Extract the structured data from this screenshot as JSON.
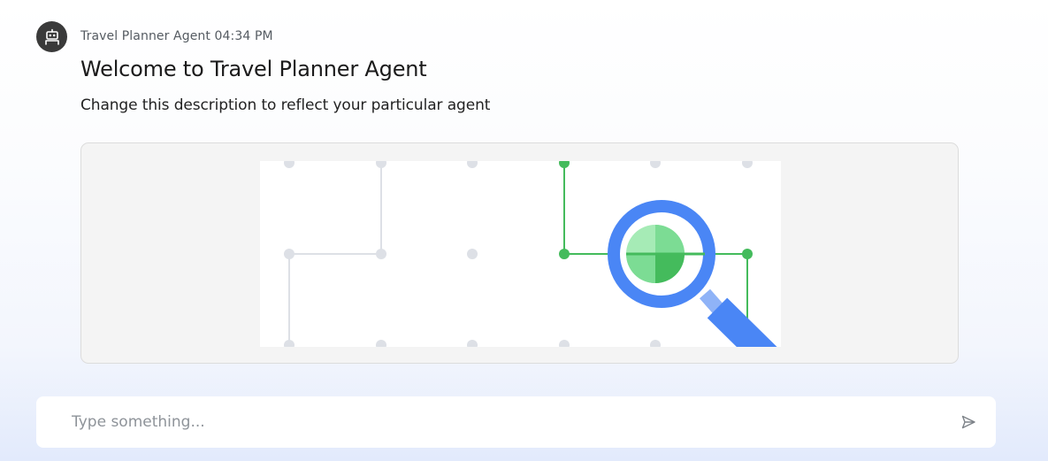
{
  "message": {
    "sender": "Travel Planner Agent",
    "time": "04:34 PM",
    "title": "Welcome to Travel Planner Agent",
    "description": "Change this description to reflect your particular agent"
  },
  "avatar": {
    "icon": "robot-icon"
  },
  "illustration": {
    "icon": "magnifier-network-icon"
  },
  "composer": {
    "placeholder": "Type something...",
    "send_icon": "send-icon"
  },
  "colors": {
    "accent_blue": "#4a86f5",
    "accent_green": "#44bb5c",
    "grid_gray": "#dde0e6"
  }
}
